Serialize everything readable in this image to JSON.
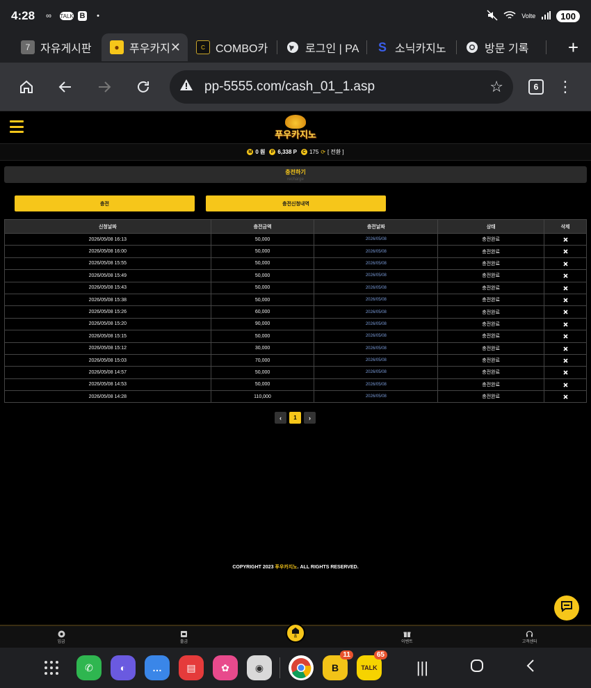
{
  "status_bar": {
    "time": "4:28",
    "battery": "100",
    "notif_icons": [
      "infinity-icon",
      "talk-icon",
      "b-icon",
      "dot-icon"
    ]
  },
  "tabs": [
    {
      "title": "자유게시판",
      "icon": "slot-icon",
      "active": false
    },
    {
      "title": "푸우카지",
      "icon": "pooh-icon",
      "active": true
    },
    {
      "title": "COMBO카",
      "icon": "combo-icon",
      "active": false
    },
    {
      "title": "로그인 | PA",
      "icon": "globe-icon",
      "active": false
    },
    {
      "title": "소닉카지노",
      "icon": "sonic-icon",
      "active": false
    },
    {
      "title": "방문 기록",
      "icon": "history-icon",
      "active": false
    }
  ],
  "toolbar": {
    "url": "pp-5555.com/cash_01_1.asp",
    "tab_count": "6"
  },
  "site": {
    "logo_text": "푸우카지노",
    "points": {
      "money": "0 원",
      "point": "6,338 P",
      "comp": "175",
      "switch_label": "[ 전환 ]"
    },
    "section_title": "충전하기",
    "section_subtitle": "recharge",
    "buttons": {
      "charge": "충전",
      "history": "충전신청내역"
    }
  },
  "table": {
    "headers": [
      "신청날짜",
      "충전금액",
      "충전날짜",
      "상태",
      "삭제"
    ],
    "rows": [
      {
        "requested": "2026/05/08 16:13",
        "amount": "50,000",
        "charged": "2026/05/08",
        "status": "충전완료"
      },
      {
        "requested": "2026/05/08 16:00",
        "amount": "50,000",
        "charged": "2026/05/08",
        "status": "충전완료"
      },
      {
        "requested": "2026/05/08 15:55",
        "amount": "50,000",
        "charged": "2026/05/08",
        "status": "충전완료"
      },
      {
        "requested": "2026/05/08 15:49",
        "amount": "50,000",
        "charged": "2026/05/08",
        "status": "충전완료"
      },
      {
        "requested": "2026/05/08 15:43",
        "amount": "50,000",
        "charged": "2026/05/08",
        "status": "충전완료"
      },
      {
        "requested": "2026/05/08 15:38",
        "amount": "50,000",
        "charged": "2026/05/08",
        "status": "충전완료"
      },
      {
        "requested": "2026/05/08 15:26",
        "amount": "60,000",
        "charged": "2026/05/08",
        "status": "충전완료"
      },
      {
        "requested": "2026/05/08 15:20",
        "amount": "90,000",
        "charged": "2026/05/08",
        "status": "충전완료"
      },
      {
        "requested": "2026/05/08 15:15",
        "amount": "50,000",
        "charged": "2026/05/08",
        "status": "충전완료"
      },
      {
        "requested": "2026/05/08 15:12",
        "amount": "30,000",
        "charged": "2026/05/08",
        "status": "충전완료"
      },
      {
        "requested": "2026/05/08 15:03",
        "amount": "70,000",
        "charged": "2026/05/08",
        "status": "충전완료"
      },
      {
        "requested": "2026/05/08 14:57",
        "amount": "50,000",
        "charged": "2026/05/08",
        "status": "충전완료"
      },
      {
        "requested": "2026/05/08 14:53",
        "amount": "50,000",
        "charged": "2026/05/08",
        "status": "충전완료"
      },
      {
        "requested": "2026/05/08 14:28",
        "amount": "110,000",
        "charged": "2026/05/08",
        "status": "충전완료"
      }
    ]
  },
  "pager": {
    "prev": "‹",
    "current": "1",
    "next": "›"
  },
  "footer": {
    "copyright_pre": "COPYRIGHT 2023 ",
    "brand": "푸우카지노",
    "copyright_post": ". ALL RIGHTS RESERVED."
  },
  "bottom_nav": [
    {
      "label": "입금",
      "icon": "deposit-icon"
    },
    {
      "label": "출금",
      "icon": "withdraw-icon"
    },
    {
      "label": "홈",
      "icon": "home-icon"
    },
    {
      "label": "이벤트",
      "icon": "gift-icon"
    },
    {
      "label": "고객센터",
      "icon": "headset-icon"
    }
  ],
  "dock": {
    "apps": [
      {
        "name": "phone",
        "color": "#2fb650"
      },
      {
        "name": "internet",
        "color": "#6a5ae0"
      },
      {
        "name": "messages",
        "color": "#3a86e8"
      },
      {
        "name": "notes",
        "color": "#e53b3b"
      },
      {
        "name": "gallery",
        "color": "#e84a8c"
      },
      {
        "name": "camera",
        "color": "#d9d9d9"
      },
      {
        "name": "chrome",
        "color": "#ffffff"
      },
      {
        "name": "band",
        "color": "#f2c318",
        "badge": "11"
      },
      {
        "name": "kakaotalk",
        "color": "#f6d300",
        "badge": "65"
      }
    ]
  }
}
